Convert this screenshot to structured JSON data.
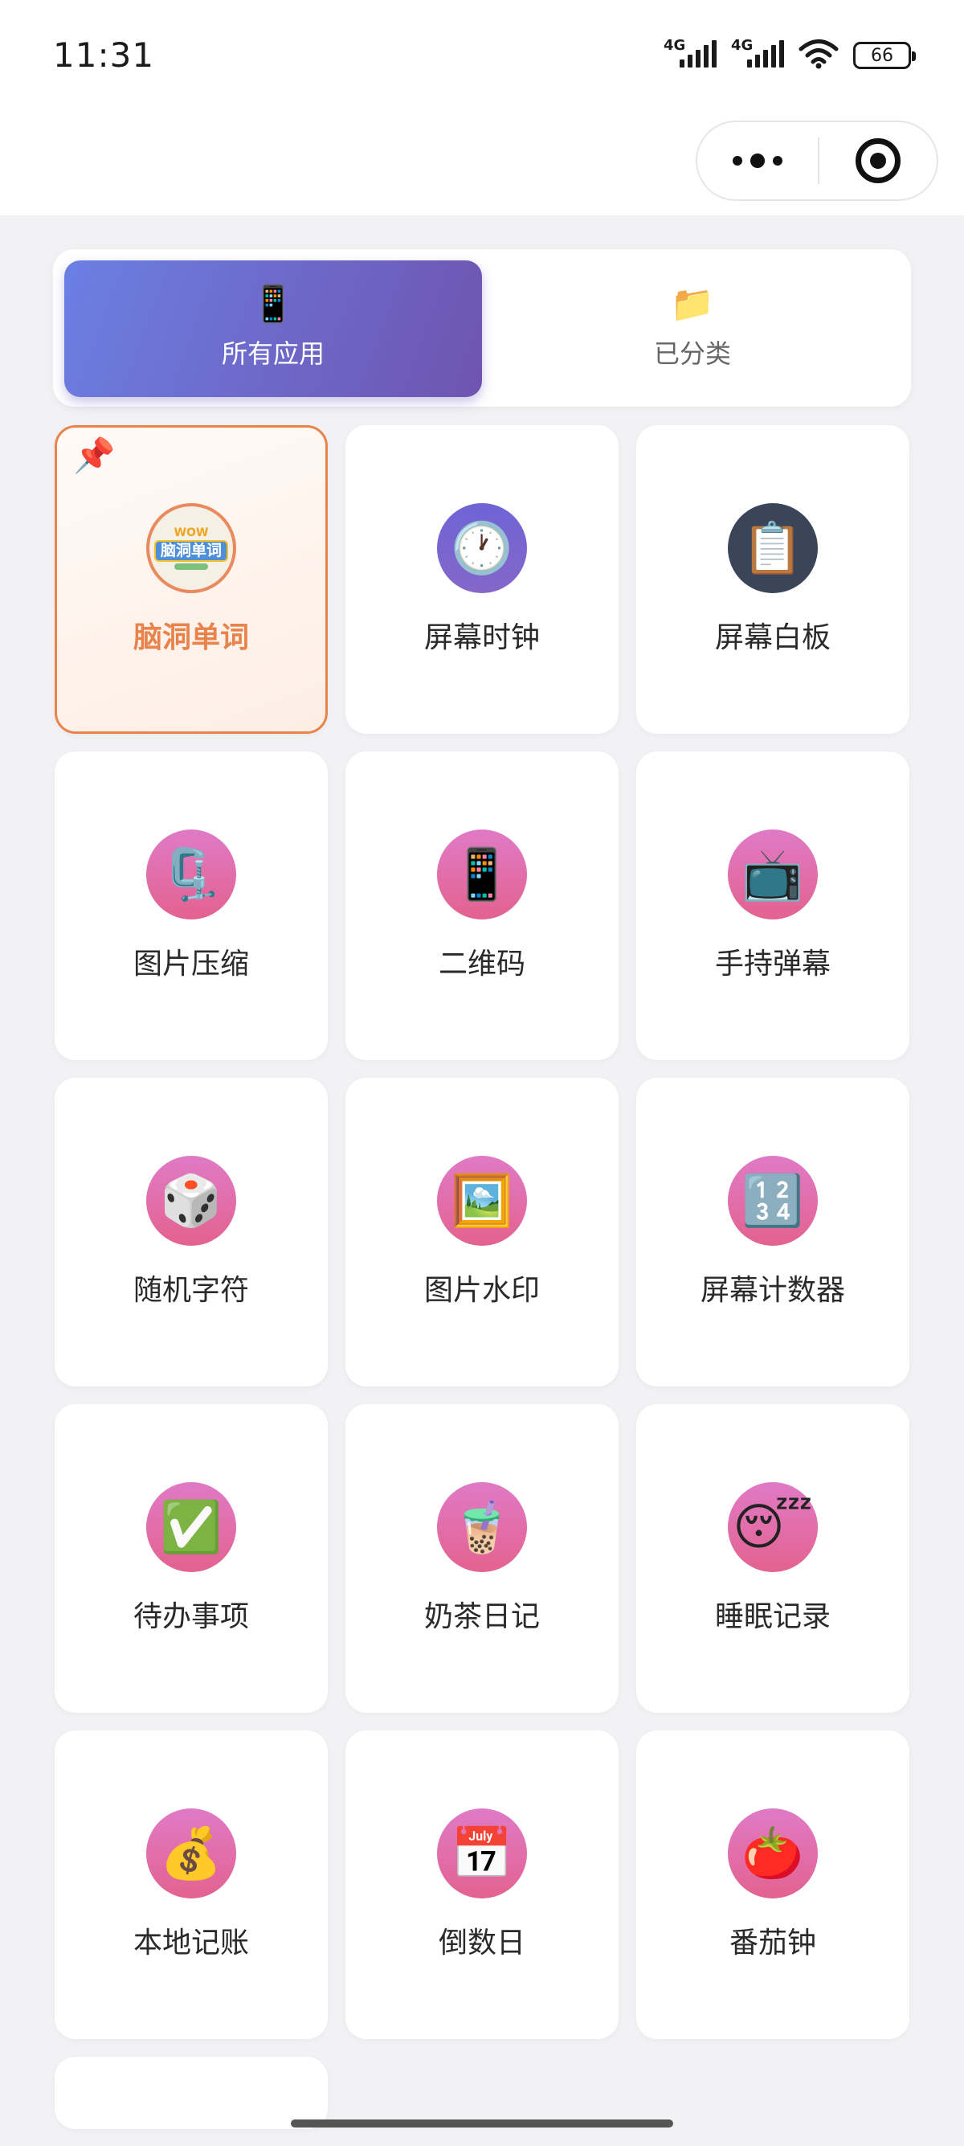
{
  "status_bar": {
    "time": "11:31",
    "network_1": "4G",
    "network_2": "4G",
    "battery": "66"
  },
  "nav": {
    "more_icon": "more-dots-icon",
    "close_icon": "target-close-icon"
  },
  "tabs": [
    {
      "icon": "📱",
      "icon_name": "mobile-phone-icon",
      "label": "所有应用",
      "active": true
    },
    {
      "icon": "📁",
      "icon_name": "folder-icon",
      "label": "已分类",
      "active": false
    }
  ],
  "apps": [
    {
      "name": "脑洞单词",
      "icon": "脑洞单词",
      "icon_name": "brain-words-logo-icon",
      "pinned": true,
      "pin_icon": "📌"
    },
    {
      "name": "屏幕时钟",
      "icon": "🕐",
      "icon_name": "clock-icon"
    },
    {
      "name": "屏幕白板",
      "icon": "📋",
      "icon_name": "clipboard-icon"
    },
    {
      "name": "图片压缩",
      "icon": "🗜️",
      "icon_name": "clamp-icon"
    },
    {
      "name": "二维码",
      "icon": "📱",
      "icon_name": "mobile-phone-icon"
    },
    {
      "name": "手持弹幕",
      "icon": "📺",
      "icon_name": "television-icon"
    },
    {
      "name": "随机字符",
      "icon": "🎲",
      "icon_name": "dice-icon"
    },
    {
      "name": "图片水印",
      "icon": "🖼️",
      "icon_name": "framed-picture-icon"
    },
    {
      "name": "屏幕计数器",
      "icon": "🔢",
      "icon_name": "numbers-icon"
    },
    {
      "name": "待办事项",
      "icon": "✅",
      "icon_name": "check-mark-icon"
    },
    {
      "name": "奶茶日记",
      "icon": "🧋",
      "icon_name": "bubble-tea-icon"
    },
    {
      "name": "睡眠记录",
      "icon": "😴",
      "icon_name": "sleeping-face-icon"
    },
    {
      "name": "本地记账",
      "icon": "💰",
      "icon_name": "money-bag-icon"
    },
    {
      "name": "倒数日",
      "icon": "📅",
      "icon_name": "calendar-icon"
    },
    {
      "name": "番茄钟",
      "icon": "🍅",
      "icon_name": "tomato-icon"
    }
  ]
}
